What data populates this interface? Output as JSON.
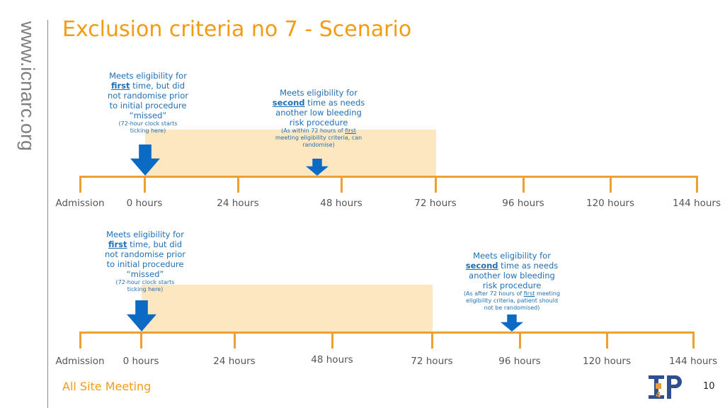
{
  "sidebar": {
    "website": "www.icnarc.org"
  },
  "title": "Exclusion criteria no 7 - Scenario",
  "timeline1": {
    "labels": [
      "Admission",
      "0 hours",
      "24 hours",
      "48 hours",
      "72 hours",
      "96 hours",
      "120 hours",
      "144 hours"
    ],
    "first": {
      "l1": "Meets eligibility for",
      "u": "first",
      "l2": " time, but did",
      "l3": "not randomise prior",
      "l4": "to initial procedure",
      "l5": "“missed”",
      "s1": "(72-hour clock starts",
      "s2": "ticking here)"
    },
    "second": {
      "l1": "Meets eligibility for",
      "u": "second",
      "l2": " time as needs",
      "l3": "another low bleeding",
      "l4": "risk procedure",
      "s1": "(As within 72 hours of ",
      "su": "first",
      "s2": "meeting eligibility criteria, can",
      "s3": "randomise)"
    }
  },
  "timeline2": {
    "labels": [
      "Admission",
      "0 hours",
      "24 hours",
      "48 hours",
      "72 hours",
      "96 hours",
      "120 hours",
      "144 hours"
    ],
    "first": {
      "l1": "Meets eligibility for",
      "u": "first",
      "l2": " time, but did",
      "l3": "not randomise prior",
      "l4": "to initial procedure",
      "l5": "“missed”",
      "s1": "(72-hour clock starts",
      "s2": "ticking here)"
    },
    "second": {
      "l1": "Meets eligibility for",
      "u": "second",
      "l2": " time as needs",
      "l3": "another low bleeding",
      "l4": "risk procedure",
      "s1": "(As after 72 hours of ",
      "su": "first",
      "s1b": " meeting",
      "s2": "eligibility criteria, patient should",
      "s3": "not be randomised)"
    }
  },
  "footer": {
    "meeting": "All Site Meeting",
    "page": "10",
    "logo": "T4P"
  },
  "colors": {
    "accent": "#f39c12",
    "text_blue": "#1f6fb5",
    "arrow": "#0b6bc4",
    "shade": "#fde3b6",
    "line": "#f0a030"
  }
}
